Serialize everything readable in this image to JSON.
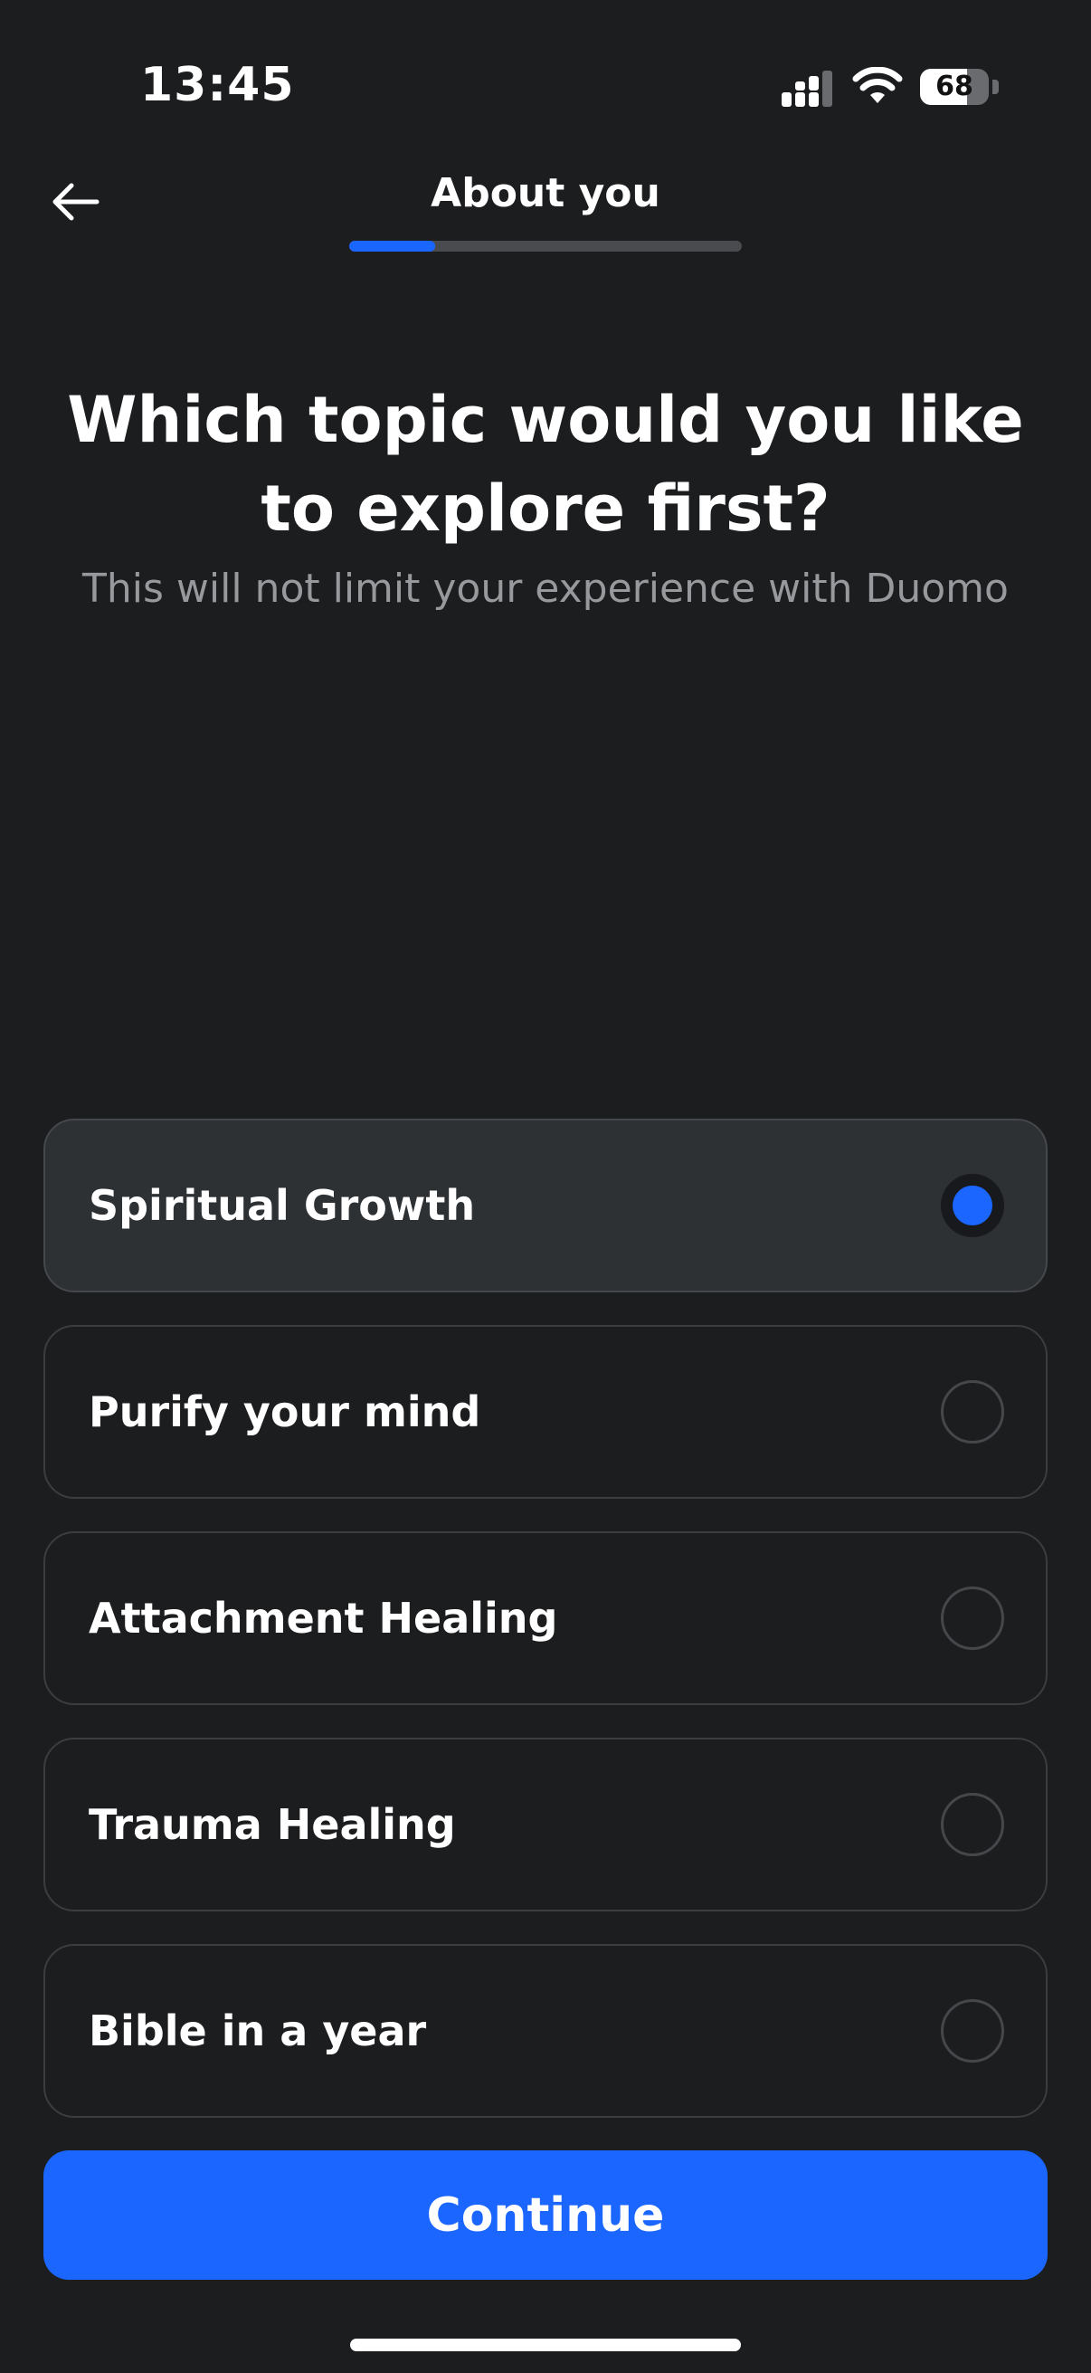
{
  "status_bar": {
    "time": "13:45",
    "battery": "68",
    "battery_level": 0.68,
    "icons": [
      "signal-icon",
      "wifi-icon",
      "battery-icon"
    ]
  },
  "header": {
    "back_icon": "arrow-left-icon",
    "title": "About you",
    "progress": 0.22
  },
  "main": {
    "question": "Which topic would you like to explore first?",
    "subtitle": "This will not limit your experience with Duomo"
  },
  "options": [
    {
      "label": "Spiritual Growth",
      "selected": true
    },
    {
      "label": "Purify your mind",
      "selected": false
    },
    {
      "label": "Attachment Healing",
      "selected": false
    },
    {
      "label": "Trauma Healing",
      "selected": false
    },
    {
      "label": "Bible in a year",
      "selected": false
    }
  ],
  "footer": {
    "continue_label": "Continue"
  },
  "colors": {
    "background": "#1c1d1f",
    "accent": "#1a66ff",
    "selected_option_bg": "#2d3134",
    "muted_text": "#97999c"
  }
}
